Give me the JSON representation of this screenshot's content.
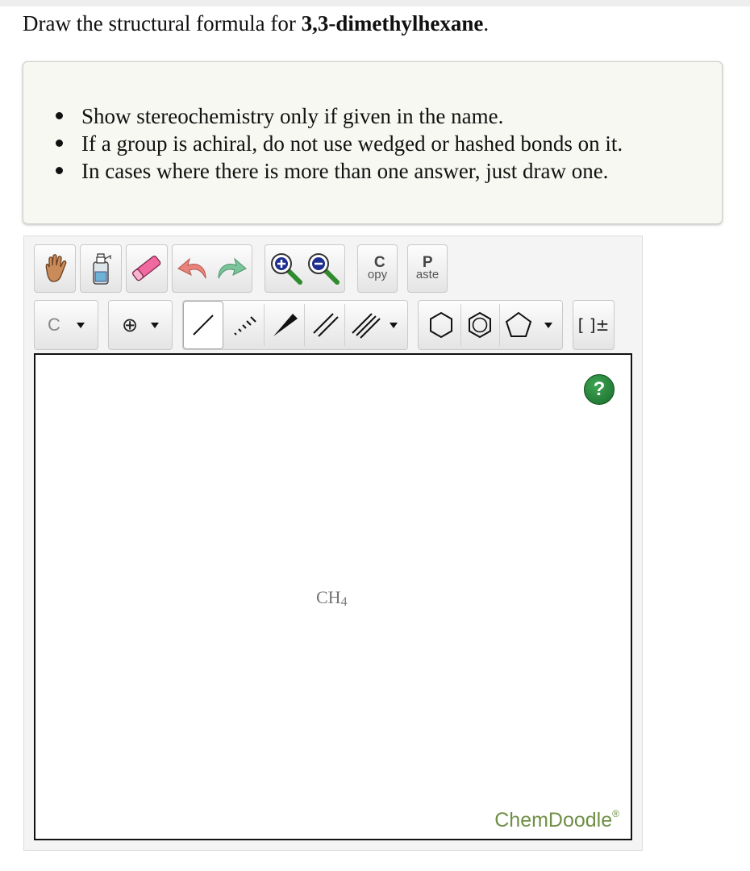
{
  "question": {
    "prefix": "Draw the structural formula for ",
    "compound": "3,3-dimethylhexane",
    "suffix": "."
  },
  "instructions": [
    "Show stereochemistry only if given in the name.",
    "If a group is achiral, do not use wedged or hashed bonds on it.",
    "In cases where there is more than one answer, just draw one."
  ],
  "toolbar": {
    "row1": [
      {
        "icon": "hand-icon"
      },
      {
        "icon": "clear-spray-icon"
      },
      {
        "icon": "eraser-icon"
      },
      {
        "icon": "undo-icon"
      },
      {
        "icon": "redo-icon"
      },
      {
        "icon": "zoom-in-icon"
      },
      {
        "icon": "zoom-out-icon"
      }
    ],
    "copy_label_big": "C",
    "copy_label_small": "opy",
    "paste_label_big": "P",
    "paste_label_small": "aste",
    "atom_label": "C",
    "charge_label": "⊕",
    "bracket_label": "[ ]±"
  },
  "canvas": {
    "molecule_main": "CH",
    "molecule_sub": "4",
    "help_label": "?",
    "brand": "ChemDoodle",
    "brand_mark": "®"
  },
  "colors": {
    "help_green": "#1e7b34",
    "brand_green": "#6f8f45",
    "eraser_pink": "#f06aa0",
    "undo_red": "#e8827a",
    "redo_green": "#7cc49a",
    "zoom_handle": "#2e8b2e"
  }
}
